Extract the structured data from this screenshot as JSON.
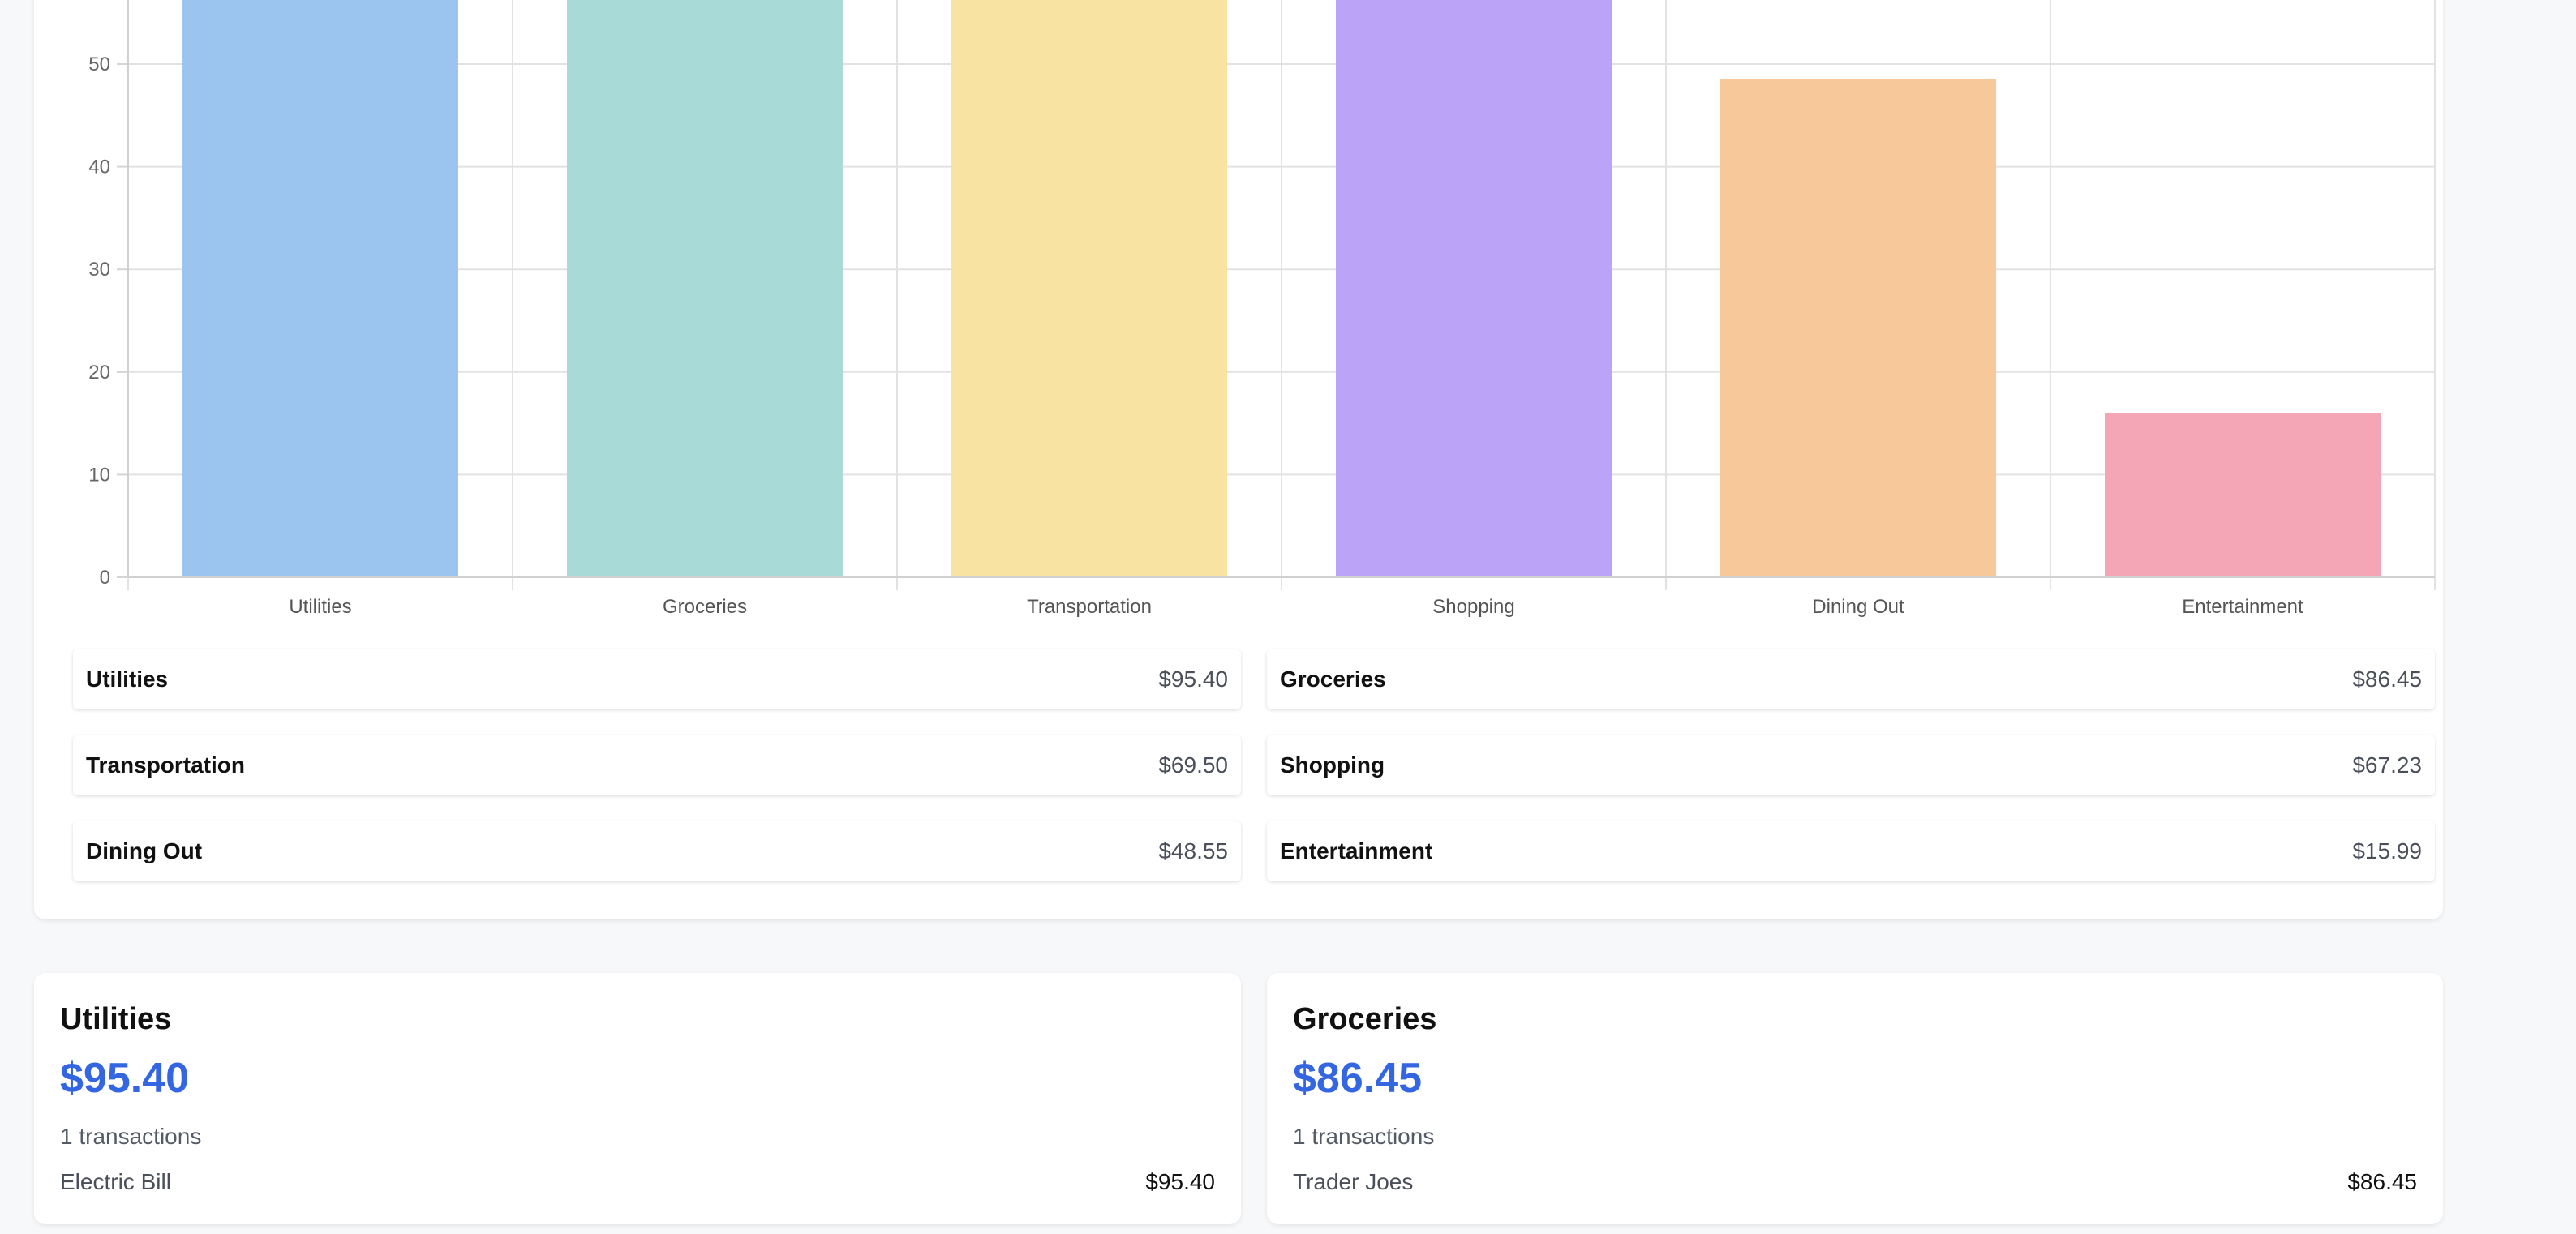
{
  "chart_data": {
    "type": "bar",
    "categories": [
      "Utilities",
      "Groceries",
      "Transportation",
      "Shopping",
      "Dining Out",
      "Entertainment"
    ],
    "values": [
      95.4,
      86.45,
      69.5,
      67.23,
      48.55,
      15.99
    ],
    "yticks": [
      "0",
      "10",
      "20",
      "30",
      "40",
      "50"
    ],
    "ylim": [
      0,
      100
    ],
    "grid": true,
    "colors": [
      "#9bc4ef",
      "#a8dbd8",
      "#f9e3a3",
      "#bba4f8",
      "#f6c89a",
      "#f4a6b7"
    ]
  },
  "summary": [
    {
      "name": "Utilities",
      "amount": "$95.40"
    },
    {
      "name": "Groceries",
      "amount": "$86.45"
    },
    {
      "name": "Transportation",
      "amount": "$69.50"
    },
    {
      "name": "Shopping",
      "amount": "$67.23"
    },
    {
      "name": "Dining Out",
      "amount": "$48.55"
    },
    {
      "name": "Entertainment",
      "amount": "$15.99"
    }
  ],
  "cards": [
    {
      "title": "Utilities",
      "total": "$95.40",
      "count": "1 transactions",
      "tx_name": "Electric Bill",
      "tx_amount": "$95.40"
    },
    {
      "title": "Groceries",
      "total": "$86.45",
      "count": "1 transactions",
      "tx_name": "Trader Joes",
      "tx_amount": "$86.45"
    }
  ]
}
